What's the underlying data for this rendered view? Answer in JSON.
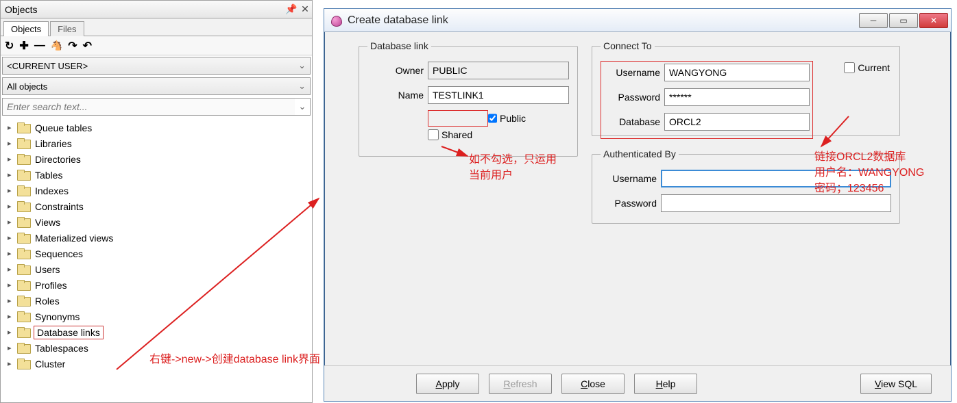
{
  "panel": {
    "title": "Objects",
    "tabs": {
      "objects": "Objects",
      "files": "Files"
    },
    "toolbar_icons": {
      "refresh": "↻",
      "add": "✚",
      "remove": "—",
      "find": "🔍",
      "next": "↷",
      "prev": "↶"
    },
    "dropdown_user": "<CURRENT USER>",
    "dropdown_filter": "All objects",
    "search_placeholder": "Enter search text...",
    "tree": [
      "Queue tables",
      "Libraries",
      "Directories",
      "Tables",
      "Indexes",
      "Constraints",
      "Views",
      "Materialized views",
      "Sequences",
      "Users",
      "Profiles",
      "Roles",
      "Synonyms",
      "Database links",
      "Tablespaces",
      "Cluster"
    ],
    "selected_index": 13
  },
  "dialog": {
    "title": "Create database link",
    "dblink_legend": "Database link",
    "owner_label": "Owner",
    "owner_value": "PUBLIC",
    "name_label": "Name",
    "name_value": "TESTLINK1",
    "public_label": "Public",
    "public_checked": true,
    "shared_label": "Shared",
    "shared_checked": false,
    "connect_legend": "Connect To",
    "ct_user_label": "Username",
    "ct_user_value": "WANGYONG",
    "ct_pass_label": "Password",
    "ct_pass_value": "******",
    "ct_db_label": "Database",
    "ct_db_value": "ORCL2",
    "ct_current_label": "Current",
    "auth_legend": "Authenticated By",
    "auth_user_label": "Username",
    "auth_user_value": "",
    "auth_pass_label": "Password",
    "auth_pass_value": "",
    "buttons": {
      "apply_u": "A",
      "apply": "pply",
      "refresh_u": "R",
      "refresh": "efresh",
      "close_u": "C",
      "close": "lose",
      "help_u": "H",
      "help": "elp",
      "viewsql_u": "V",
      "viewsql": "iew SQL"
    }
  },
  "annotations": {
    "bottom": "右键->new->创建database link界面",
    "public_note_l1": "如不勾选，只运用",
    "public_note_l2": "当前用户",
    "right_l1": "链接ORCL2数据库",
    "right_l2": "用户名：WANGYONG",
    "right_l3": "密码；123456"
  }
}
